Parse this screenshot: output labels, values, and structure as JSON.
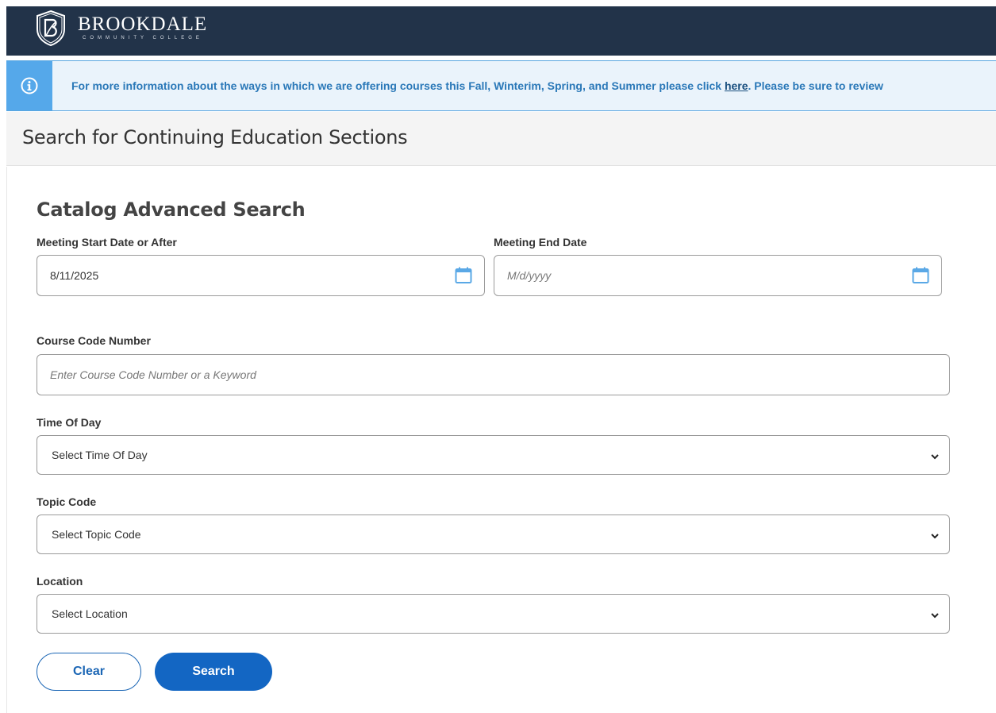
{
  "header": {
    "college_name": "BROOKDALE",
    "college_subtitle": "COMMUNITY COLLEGE",
    "brand_color": "#223349"
  },
  "banner": {
    "icon": "info-icon",
    "text_before": "For more information about the ways in which we are offering courses this Fall, Winterim, Spring, and Summer please click ",
    "link_text": "here",
    "text_after": ". Please be sure to review",
    "accent_color": "#55a8ea"
  },
  "page": {
    "title": "Search for Continuing Education Sections"
  },
  "form": {
    "title": "Catalog Advanced Search",
    "start_date": {
      "label": "Meeting Start Date or After",
      "value": "8/11/2025",
      "icon": "calendar-icon"
    },
    "end_date": {
      "label": "Meeting End Date",
      "placeholder": "M/d/yyyy",
      "icon": "calendar-icon"
    },
    "course_code": {
      "label": "Course Code Number",
      "placeholder": "Enter Course Code Number or a Keyword"
    },
    "time_of_day": {
      "label": "Time Of Day",
      "selected": "Select Time Of Day"
    },
    "topic_code": {
      "label": "Topic Code",
      "selected": "Select Topic Code"
    },
    "location": {
      "label": "Location",
      "selected": "Select Location"
    },
    "clear_label": "Clear",
    "search_label": "Search",
    "button_color": "#1366c3"
  }
}
